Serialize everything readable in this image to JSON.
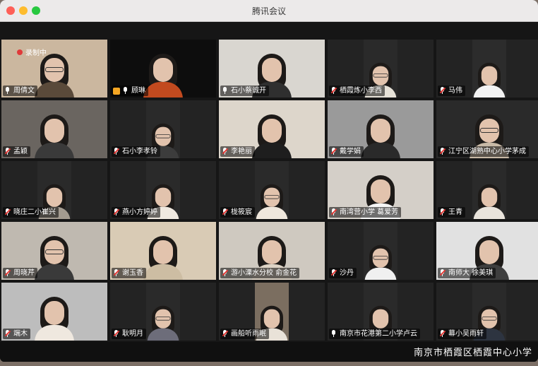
{
  "window": {
    "title": "腾讯会议"
  },
  "recording": {
    "label": "录制中"
  },
  "banner": {
    "text": "南京市栖霞区栖霞中心小学"
  },
  "participants": [
    {
      "name": "周倩文",
      "muted": false
    },
    {
      "name": "顾琳",
      "muted": false,
      "active": true,
      "host": true
    },
    {
      "name": "石小蔡诚开",
      "muted": false
    },
    {
      "name": "栖霞炼小李西",
      "muted": true
    },
    {
      "name": "马伟",
      "muted": true
    },
    {
      "name": "孟颖",
      "muted": true
    },
    {
      "name": "石小李孝铃",
      "muted": true
    },
    {
      "name": "李艳丽",
      "muted": true
    },
    {
      "name": "戴学娟",
      "muted": true
    },
    {
      "name": "江宁区湖熟中心小学茅成",
      "muted": true
    },
    {
      "name": "晓庄二小崔兴",
      "muted": true
    },
    {
      "name": "燕小方婷婷",
      "muted": true
    },
    {
      "name": "栊筱宸",
      "muted": true
    },
    {
      "name": "南湾营小学 葛爱芳",
      "muted": true
    },
    {
      "name": "王青",
      "muted": true
    },
    {
      "name": "周晓芹",
      "muted": true
    },
    {
      "name": "谢玉香",
      "muted": true
    },
    {
      "name": "游小溧水分校 俞金花",
      "muted": true
    },
    {
      "name": "沙丹",
      "muted": true
    },
    {
      "name": "南师大 徐美琪",
      "muted": true
    },
    {
      "name": "端木",
      "muted": true
    },
    {
      "name": "耿明月",
      "muted": true
    },
    {
      "name": "画船听雨眠",
      "muted": true
    },
    {
      "name": "南京市花港第二小学卢云",
      "muted": false
    },
    {
      "name": "幕小吴雨轩",
      "muted": true
    }
  ]
}
